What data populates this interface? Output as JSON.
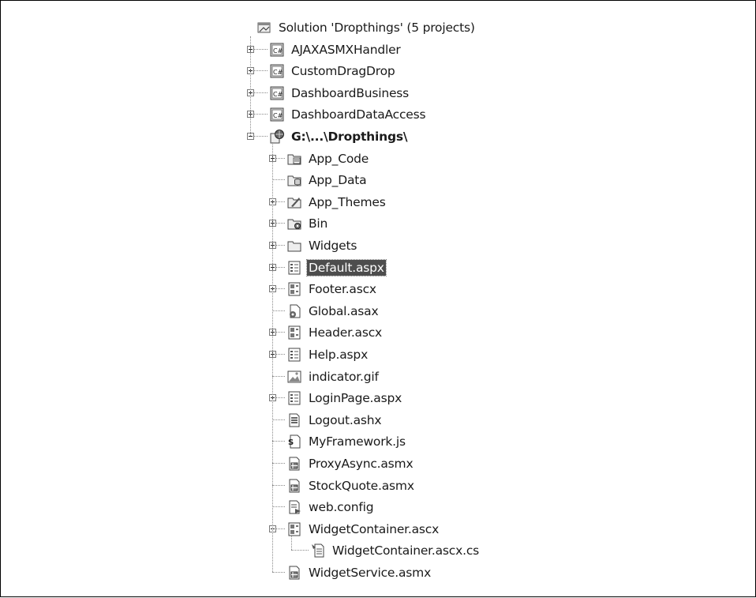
{
  "solution": {
    "label": "Solution 'Dropthings' (5 projects)",
    "icon": "solution-icon",
    "projects": [
      {
        "name": "AJAXASMXHandler",
        "icon": "csharp-project-icon",
        "expander": "collapsed"
      },
      {
        "name": "CustomDragDrop",
        "icon": "csharp-project-icon",
        "expander": "collapsed"
      },
      {
        "name": "DashboardBusiness",
        "icon": "csharp-project-icon",
        "expander": "collapsed"
      },
      {
        "name": "DashboardDataAccess",
        "icon": "csharp-project-icon",
        "expander": "collapsed"
      },
      {
        "name": "G:\\...\\Dropthings\\",
        "icon": "website-project-icon",
        "expander": "expanded",
        "items": [
          {
            "name": "App_Code",
            "icon": "app-code-folder-icon",
            "expander": "collapsed"
          },
          {
            "name": "App_Data",
            "icon": "app-data-folder-icon",
            "expander": "none"
          },
          {
            "name": "App_Themes",
            "icon": "app-themes-folder-icon",
            "expander": "collapsed"
          },
          {
            "name": "Bin",
            "icon": "bin-folder-icon",
            "expander": "collapsed"
          },
          {
            "name": "Widgets",
            "icon": "folder-icon",
            "expander": "collapsed"
          },
          {
            "name": "Default.aspx",
            "icon": "aspx-file-icon",
            "expander": "collapsed",
            "selected": true
          },
          {
            "name": "Footer.ascx",
            "icon": "ascx-file-icon",
            "expander": "collapsed"
          },
          {
            "name": "Global.asax",
            "icon": "asax-file-icon",
            "expander": "none"
          },
          {
            "name": "Header.ascx",
            "icon": "ascx-file-icon",
            "expander": "collapsed"
          },
          {
            "name": "Help.aspx",
            "icon": "aspx-file-icon",
            "expander": "collapsed"
          },
          {
            "name": "indicator.gif",
            "icon": "image-file-icon",
            "expander": "none"
          },
          {
            "name": "LoginPage.aspx",
            "icon": "aspx-file-icon",
            "expander": "collapsed"
          },
          {
            "name": "Logout.ashx",
            "icon": "ashx-file-icon",
            "expander": "none"
          },
          {
            "name": "MyFramework.js",
            "icon": "js-file-icon",
            "expander": "none"
          },
          {
            "name": "ProxyAsync.asmx",
            "icon": "asmx-file-icon",
            "expander": "none"
          },
          {
            "name": "StockQuote.asmx",
            "icon": "asmx-file-icon",
            "expander": "none"
          },
          {
            "name": "web.config",
            "icon": "config-file-icon",
            "expander": "none"
          },
          {
            "name": "WidgetContainer.ascx",
            "icon": "ascx-file-icon",
            "expander": "expanded",
            "children": [
              {
                "name": "WidgetContainer.ascx.cs",
                "icon": "cs-code-file-icon",
                "expander": "none"
              }
            ]
          },
          {
            "name": "WidgetService.asmx",
            "icon": "asmx-file-icon",
            "expander": "none"
          }
        ]
      }
    ]
  }
}
